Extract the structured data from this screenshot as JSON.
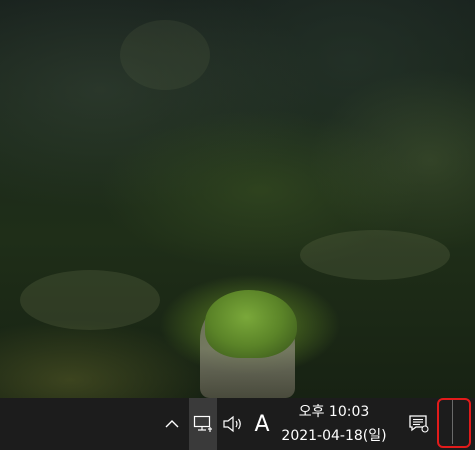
{
  "taskbar": {
    "tray": {
      "show_hidden_icons": "chevron-up-icon",
      "network": "network-monitor-icon",
      "volume": "speaker-icon",
      "ime_label": "A"
    },
    "clock": {
      "time": "오후 10:03",
      "date": "2021-04-18(일)"
    },
    "notifications": "action-center-icon",
    "show_desktop": "show-desktop-button"
  },
  "highlight": {
    "target": "show-desktop-button",
    "color": "#e21b1b"
  },
  "colors": {
    "taskbar_bg": "#1c1c1c",
    "taskbar_text": "#ffffff"
  }
}
